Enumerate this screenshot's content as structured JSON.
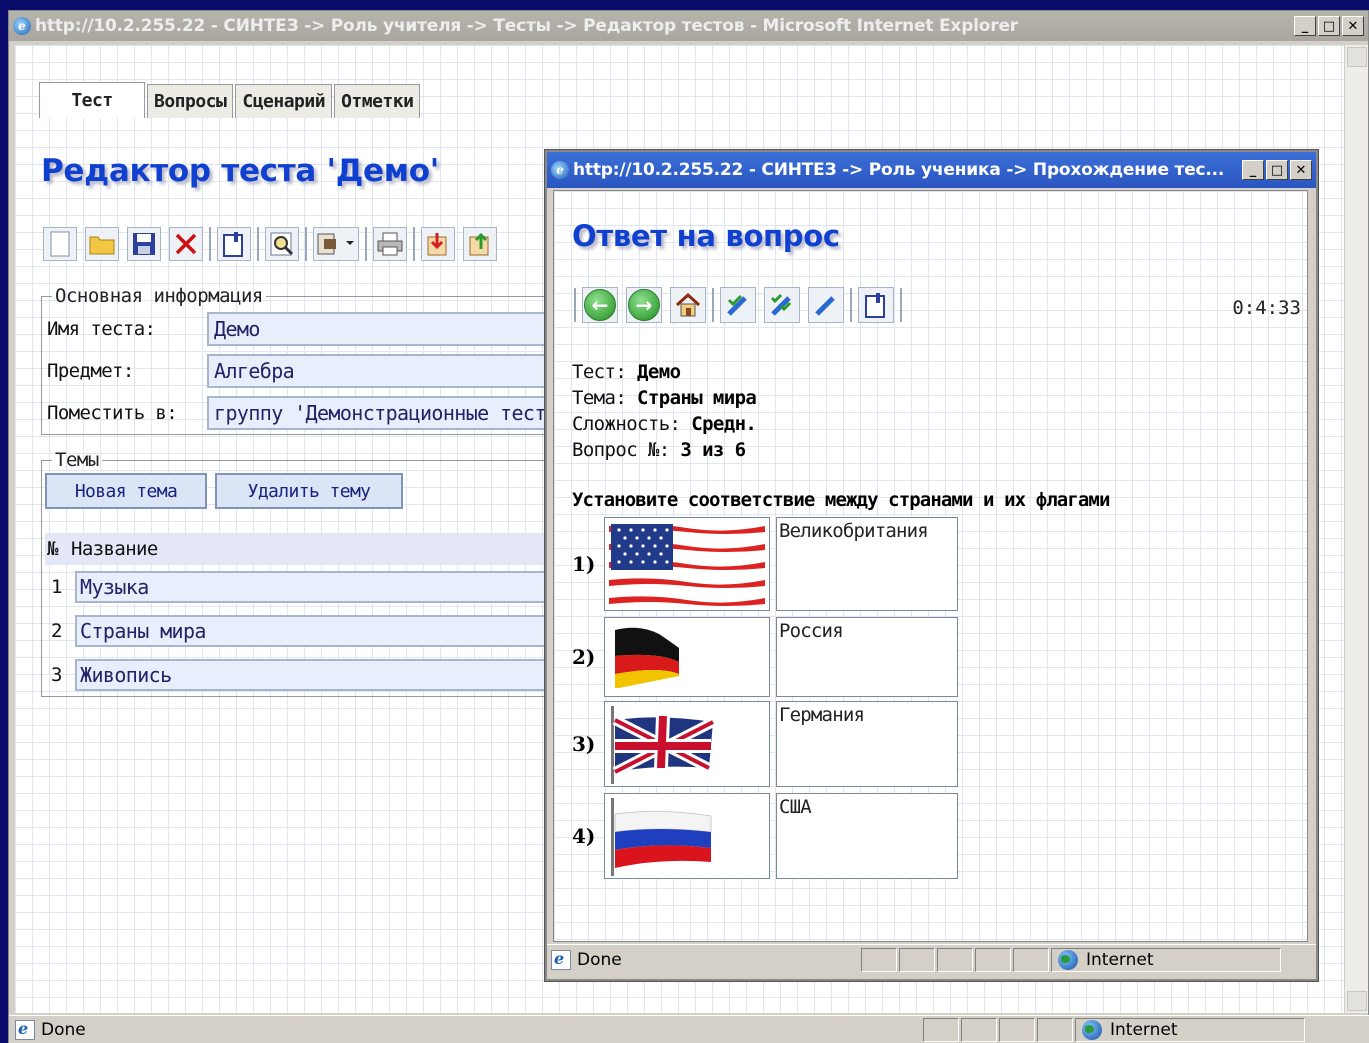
{
  "outer_window": {
    "title": "http://10.2.255.22 - СИНТЕЗ -> Роль учителя -> Тесты -> Редактор тестов - Microsoft Internet Explorer",
    "status_text": "Done",
    "zone_text": "Internet"
  },
  "tabs": [
    {
      "label": "Тест",
      "active": true
    },
    {
      "label": "Вопросы",
      "active": false
    },
    {
      "label": "Сценарий",
      "active": false
    },
    {
      "label": "Отметки",
      "active": false
    }
  ],
  "editor": {
    "title": "Редактор теста 'Демо'",
    "toolbar_icons": [
      "new-icon",
      "open-folder-icon",
      "save-icon",
      "delete-icon",
      "properties-icon",
      "preview-icon",
      "export-icon",
      "print-icon",
      "import-icon",
      "upload-icon"
    ],
    "main_info": {
      "legend": "Основная информация",
      "name_label": "Имя теста:",
      "name_value": "Демо",
      "subject_label": "Предмет:",
      "subject_value": "Алгебра",
      "place_label": "Поместить в:",
      "place_value": "группу 'Демонстрационные тест"
    },
    "topics": {
      "legend": "Темы",
      "new_button": "Новая тема",
      "delete_button": "Удалить тему",
      "col_num": "№",
      "col_name": "Название",
      "rows": [
        {
          "num": "1",
          "name": "Музыка"
        },
        {
          "num": "2",
          "name": "Страны мира"
        },
        {
          "num": "3",
          "name": "Живопись"
        }
      ]
    }
  },
  "inner_window": {
    "title": "http://10.2.255.22 - СИНТЕЗ -> Роль ученика -> Прохождение тес...",
    "status_text": "Done",
    "zone_text": "Internet",
    "page_title": "Ответ на вопрос",
    "timer": "0:4:33",
    "toolbar_icons": [
      "back-icon",
      "forward-icon",
      "home-icon",
      "mark-icon",
      "mark-all-icon",
      "finish-icon",
      "info-icon"
    ],
    "meta": {
      "test_label": "Тест:",
      "test_value": "Демо",
      "topic_label": "Тема:",
      "topic_value": "Страны мира",
      "difficulty_label": "Сложность:",
      "difficulty_value": "Средн.",
      "question_label": "Вопрос №:",
      "question_value": "3 из 6"
    },
    "question": "Установите соответствие между странами и их флагами",
    "matches": [
      {
        "num": "1)",
        "flag": "usa-flag",
        "answer": "Великобритания"
      },
      {
        "num": "2)",
        "flag": "germany-flag",
        "answer": "Россия"
      },
      {
        "num": "3)",
        "flag": "uk-flag",
        "answer": "Германия"
      },
      {
        "num": "4)",
        "flag": "russia-flag",
        "answer": "США"
      }
    ]
  }
}
